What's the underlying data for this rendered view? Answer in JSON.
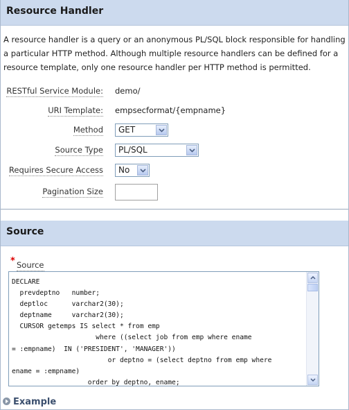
{
  "resource_handler": {
    "title": "Resource Handler",
    "description": "A resource handler is a query or an anonymous PL/SQL block responsible for handling a particular HTTP method. Although multiple resource handlers can be defined for a resource template, only one resource handler per HTTP method is permitted.",
    "fields": {
      "module_label": "RESTful Service Module:",
      "module_value": "demo/",
      "uri_label": "URI Template:",
      "uri_value": "empsecformat/{empname}",
      "method_label": "Method",
      "method_value": "GET",
      "source_type_label": "Source Type",
      "source_type_value": "PL/SQL",
      "secure_label": "Requires Secure Access",
      "secure_value": "No",
      "pagination_label": "Pagination Size",
      "pagination_value": ""
    }
  },
  "source": {
    "title": "Source",
    "required_marker": "*",
    "field_label": "Source",
    "code": "DECLARE\n  prevdeptno   number;\n  deptloc      varchar2(30);\n  deptname     varchar2(30);\n  CURSOR getemps IS select * from emp\n                     where ((select job from emp where ename\n= :empname)  IN ('PRESIDENT', 'MANAGER'))\n                        or deptno = (select deptno from emp where\nename = :empname)\n                   order by deptno, ename;"
  },
  "example": {
    "label": "Example"
  },
  "colors": {
    "header_bg": "#ccdaee",
    "required": "#dd0000",
    "example_text": "#3b4f6e"
  }
}
